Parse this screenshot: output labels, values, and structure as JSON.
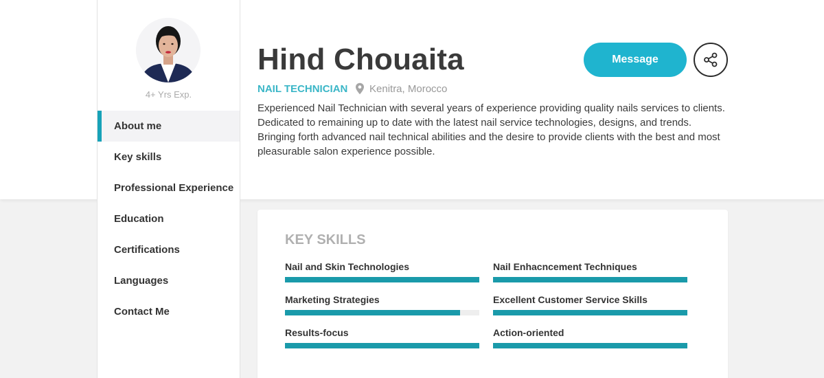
{
  "profile": {
    "name": "Hind Chouaita",
    "role": "NAIL TECHNICIAN",
    "location": "Kenitra, Morocco",
    "experience": "4+ Yrs Exp.",
    "bio": "Experienced Nail Technician with several years of experience providing quality nails services to clients. Dedicated to remaining up to date with the latest nail service technologies, designs, and trends. Bringing forth advanced nail technical abilities and the desire to provide clients with the best and most pleasurable salon experience possible."
  },
  "actions": {
    "message_label": "Message",
    "share_icon": "share-icon"
  },
  "nav": {
    "items": [
      {
        "label": "About me",
        "active": true
      },
      {
        "label": "Key skills",
        "active": false
      },
      {
        "label": "Professional Experience",
        "active": false
      },
      {
        "label": "Education",
        "active": false
      },
      {
        "label": "Certifications",
        "active": false
      },
      {
        "label": "Languages",
        "active": false
      },
      {
        "label": "Contact Me",
        "active": false
      }
    ]
  },
  "skills": {
    "title": "KEY SKILLS",
    "items": [
      {
        "label": "Nail and Skin Technologies",
        "level": 1.0
      },
      {
        "label": "Nail Enhacncement Techniques",
        "level": 1.0
      },
      {
        "label": "Marketing Strategies",
        "level": 0.9
      },
      {
        "label": "Excellent Customer Service Skills",
        "level": 1.0
      },
      {
        "label": "Results-focus",
        "level": 1.0
      },
      {
        "label": "Action-oriented",
        "level": 1.0
      }
    ]
  },
  "colors": {
    "accent": "#1fb4cf",
    "role_text": "#3ab6c7",
    "bar_fill": "#1a9aaa",
    "bar_track": "#eeeeee"
  }
}
